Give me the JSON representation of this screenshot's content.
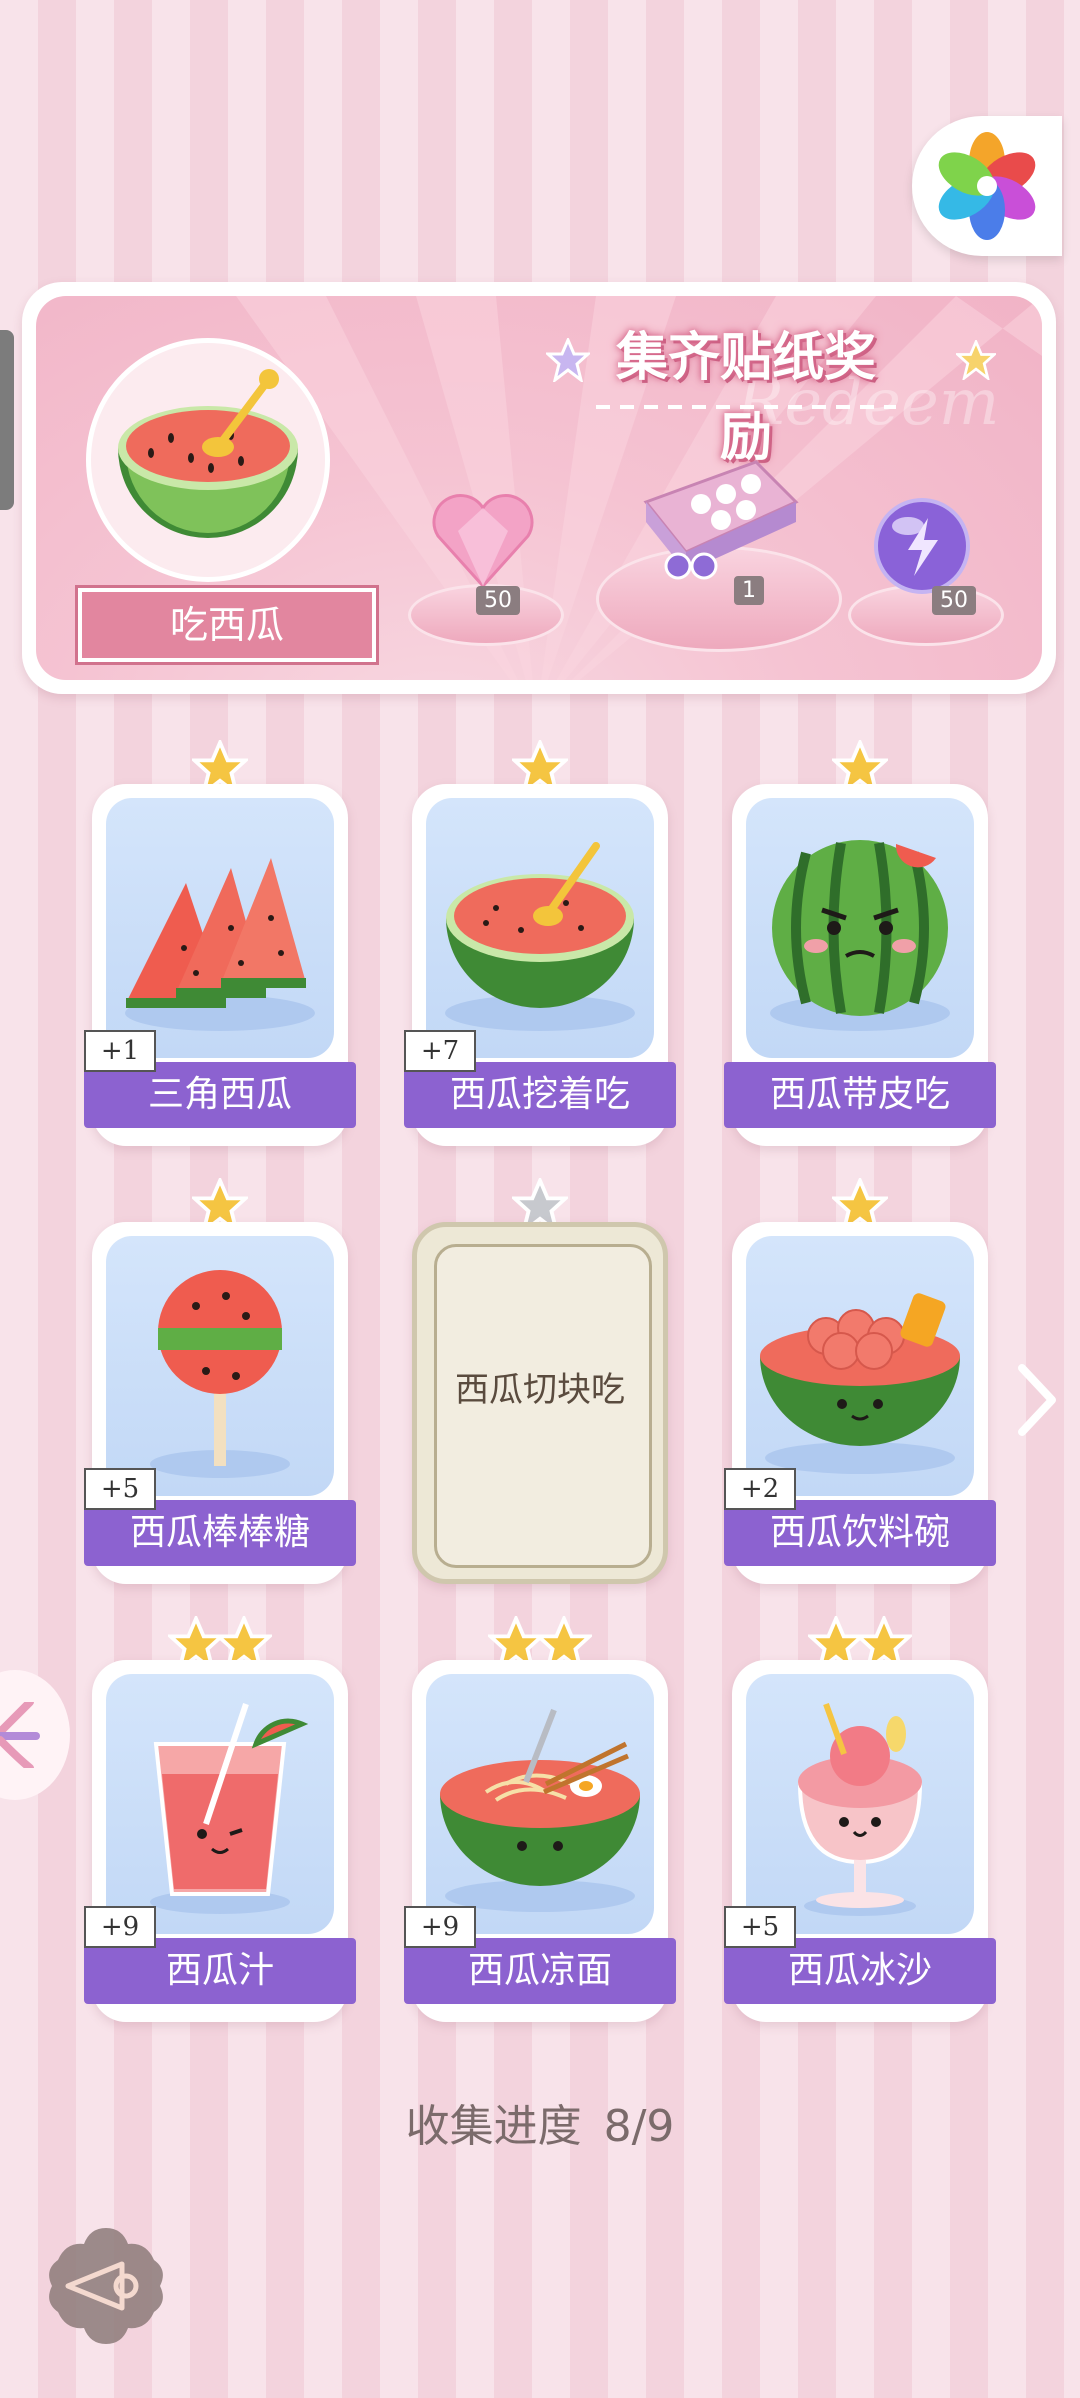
{
  "banner": {
    "title": "集齐贴纸奖励",
    "watermark": "Redeem",
    "sticker_name": "吃西瓜",
    "rewards": [
      {
        "icon": "pink-heart-gem-icon",
        "count": "50"
      },
      {
        "icon": "gift-box-icon",
        "count": "1"
      },
      {
        "icon": "energy-orb-icon",
        "count": "50"
      }
    ]
  },
  "cards": [
    {
      "name": "三角西瓜",
      "count": "+1",
      "stars": 1,
      "icon": "watermelon-slices-icon"
    },
    {
      "name": "西瓜挖着吃",
      "count": "+7",
      "stars": 1,
      "icon": "half-watermelon-spoon-icon"
    },
    {
      "name": "西瓜带皮吃",
      "count": "",
      "stars": 1,
      "icon": "angry-watermelon-icon"
    },
    {
      "name": "西瓜棒棒糖",
      "count": "+5",
      "stars": 1,
      "icon": "watermelon-lollipop-icon"
    },
    {
      "name": "西瓜切块吃",
      "count": "",
      "stars": 1,
      "locked": true
    },
    {
      "name": "西瓜饮料碗",
      "count": "+2",
      "stars": 1,
      "icon": "watermelon-drink-bowl-icon"
    },
    {
      "name": "西瓜汁",
      "count": "+9",
      "stars": 2,
      "icon": "watermelon-juice-icon"
    },
    {
      "name": "西瓜凉面",
      "count": "+9",
      "stars": 2,
      "icon": "watermelon-noodles-icon"
    },
    {
      "name": "西瓜冰沙",
      "count": "+5",
      "stars": 2,
      "icon": "watermelon-smoothie-icon"
    }
  ],
  "progress": {
    "label": "收集进度",
    "value": "8/9"
  },
  "colors": {
    "accent_purple": "#8c62d0",
    "banner_pink": "#f1b3c6",
    "star_gold": "#f5c542"
  }
}
